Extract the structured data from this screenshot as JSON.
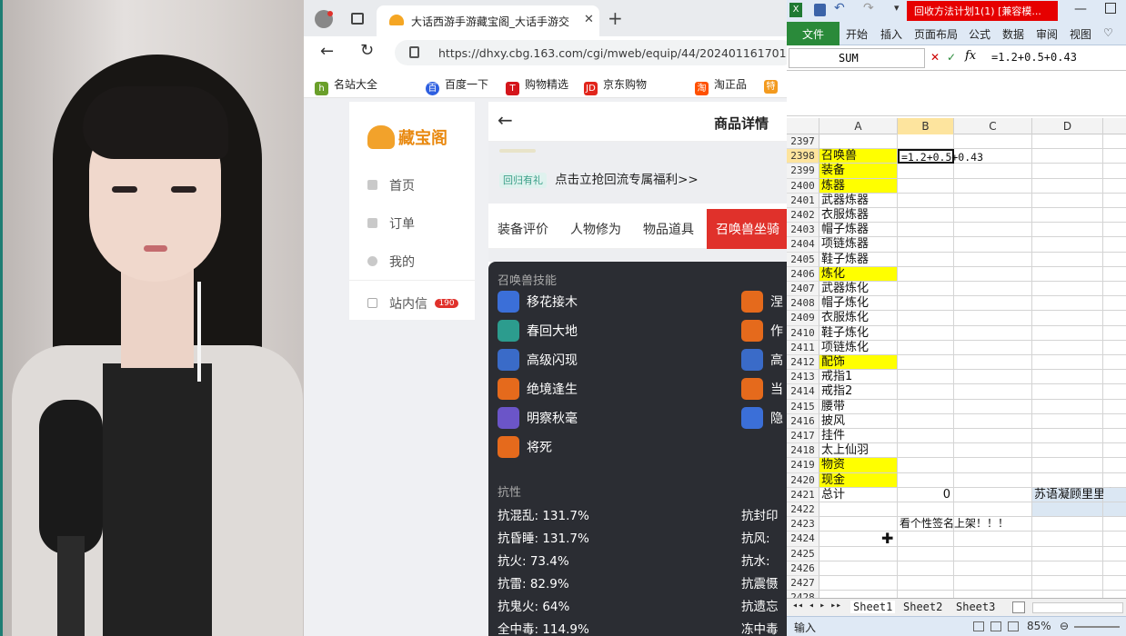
{
  "browser": {
    "tab_title": "大话西游手游藏宝阁_大话手游交",
    "url": "https://dhxy.cbg.163.com/cgi/mweb/equip/44/202401161701",
    "bookmarks": [
      "名站大全",
      "百度一下",
      "购物精选",
      "京东购物",
      "淘正品"
    ],
    "bookmark_icons": [
      "hao-icon",
      "file-icon",
      "baidu-icon",
      "tmall-icon",
      "jd-icon",
      "file-icon",
      "tao-icon",
      "te-icon"
    ],
    "logo_text": "藏宝阁",
    "sidebar": [
      {
        "label": "首页"
      },
      {
        "label": "订单"
      },
      {
        "label": "我的"
      },
      {
        "label": "站内信",
        "badge": "190"
      }
    ],
    "page_title": "商品详情",
    "promo_tag": "回归有礼",
    "promo_text": "点击立抢回流专属福利>>",
    "tabs": [
      "装备评价",
      "人物修为",
      "物品道具",
      "召唤兽坐骑"
    ],
    "skills_header": "召唤兽技能",
    "skills_left": [
      "移花接木",
      "春回大地",
      "高级闪现",
      "绝境逢生",
      "明察秋毫",
      "将死"
    ],
    "skills_right": [
      "涅",
      "作",
      "高",
      "当",
      "隐"
    ],
    "resist_header": "抗性",
    "resist_left": [
      "抗混乱: 131.7%",
      "抗昏睡: 131.7%",
      "抗火: 73.4%",
      "抗雷: 82.9%",
      "抗鬼火: 64%",
      "全中毒: 114.9%"
    ],
    "resist_right": [
      "抗封印",
      "抗风: ",
      "抗水: ",
      "抗震慑",
      "抗遗忘",
      "冻中毒"
    ]
  },
  "excel": {
    "window_title": "回收方法计划1(1) [兼容模...",
    "ribbon_tabs": [
      "文件",
      "开始",
      "插入",
      "页面布局",
      "公式",
      "数据",
      "审阅",
      "视图"
    ],
    "name_box": "SUM",
    "formula_text": "=1.2+0.5+0.43",
    "columns": [
      "A",
      "B",
      "C",
      "D"
    ],
    "rows": [
      {
        "n": "2397",
        "a": "",
        "yel": false
      },
      {
        "n": "2398",
        "a": "召唤兽",
        "yel": true,
        "b": "=1.2+0.5+0.43"
      },
      {
        "n": "2399",
        "a": "装备",
        "yel": true
      },
      {
        "n": "2400",
        "a": "炼器",
        "yel": true
      },
      {
        "n": "2401",
        "a": "武器炼器",
        "yel": false
      },
      {
        "n": "2402",
        "a": "衣服炼器",
        "yel": false
      },
      {
        "n": "2403",
        "a": "帽子炼器",
        "yel": false
      },
      {
        "n": "2404",
        "a": "项链炼器",
        "yel": false
      },
      {
        "n": "2405",
        "a": "鞋子炼器",
        "yel": false
      },
      {
        "n": "2406",
        "a": "炼化",
        "yel": true
      },
      {
        "n": "2407",
        "a": "武器炼化",
        "yel": false
      },
      {
        "n": "2408",
        "a": "帽子炼化",
        "yel": false
      },
      {
        "n": "2409",
        "a": "衣服炼化",
        "yel": false
      },
      {
        "n": "2410",
        "a": "鞋子炼化",
        "yel": false
      },
      {
        "n": "2411",
        "a": "项链炼化",
        "yel": false
      },
      {
        "n": "2412",
        "a": "配饰",
        "yel": true
      },
      {
        "n": "2413",
        "a": "戒指1",
        "yel": false
      },
      {
        "n": "2414",
        "a": "戒指2",
        "yel": false
      },
      {
        "n": "2415",
        "a": "腰带",
        "yel": false
      },
      {
        "n": "2416",
        "a": "披风",
        "yel": false
      },
      {
        "n": "2417",
        "a": "挂件",
        "yel": false
      },
      {
        "n": "2418",
        "a": "太上仙羽",
        "yel": false
      },
      {
        "n": "2419",
        "a": "物资",
        "yel": true
      },
      {
        "n": "2420",
        "a": "现金",
        "yel": true
      },
      {
        "n": "2421",
        "a": "总计",
        "yel": false,
        "b": "0",
        "d": "苏语凝顾里里专业"
      },
      {
        "n": "2422",
        "a": "",
        "yel": false
      },
      {
        "n": "2423",
        "a": "",
        "yel": false,
        "b": "看个性签名上架！！！"
      },
      {
        "n": "2424",
        "a": "",
        "yel": false
      },
      {
        "n": "2425",
        "a": "",
        "yel": false
      },
      {
        "n": "2426",
        "a": "",
        "yel": false
      },
      {
        "n": "2427",
        "a": "",
        "yel": false
      },
      {
        "n": "2428",
        "a": "",
        "yel": false
      }
    ],
    "sheets": [
      "Sheet1",
      "Sheet2",
      "Sheet3"
    ],
    "status_mode": "输入",
    "zoom": "85%"
  },
  "colors": {
    "accent_red": "#e0312b",
    "cell_yellow": "#ffff00",
    "excel_green": "#2a8a3a"
  }
}
